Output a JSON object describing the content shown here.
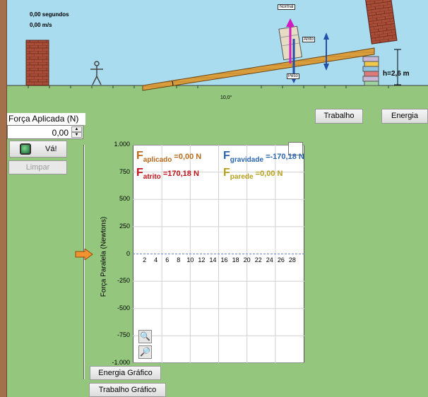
{
  "readouts": {
    "time": "0,00 segundos",
    "velocity": "0,00 m/s"
  },
  "scene": {
    "angle_label": "10,0°",
    "height_label": "h=2,6 m",
    "normal_label": "Normal",
    "friction_label": "Atrito",
    "weight_label": "Peso"
  },
  "controls": {
    "applied_force_title": "Força Aplicada (N)",
    "applied_force_value": "0,00",
    "go_label": "Vá!",
    "clear_label": "Limpar",
    "work_label": "Trabalho",
    "energy_label": "Energia",
    "energy_graph_label": "Energia Gráfico",
    "work_graph_label": "Trabalho Gráfico"
  },
  "forces": {
    "applied": {
      "sym": "F",
      "sub": "aplicado",
      "value": "=0,00 N",
      "color": "#b86a1b"
    },
    "friction": {
      "sym": "F",
      "sub": "atrito",
      "value": "=170,18 N",
      "color": "#c0141c"
    },
    "gravity": {
      "sym": "F",
      "sub": "gravidade",
      "value": "=-170,18 N",
      "color": "#2a66b0"
    },
    "wall": {
      "sym": "F",
      "sub": "parede",
      "value": "=0,00 N",
      "color": "#b5a01a"
    }
  },
  "chart_data": {
    "type": "line",
    "ylabel": "Força Paralela (Newtons)",
    "ylim": [
      -1000,
      1000
    ],
    "yticks": [
      "1.000",
      "750",
      "500",
      "250",
      "0",
      "-250",
      "-500",
      "-750",
      "-1.000"
    ],
    "ytick_values": [
      1000,
      750,
      500,
      250,
      0,
      -250,
      -500,
      -750,
      -1000
    ],
    "xlim": [
      0,
      30
    ],
    "xticks": [
      2,
      4,
      6,
      8,
      10,
      12,
      14,
      16,
      18,
      20,
      22,
      24,
      26,
      28
    ],
    "series": []
  },
  "colors": {
    "sky": "#a9dcef",
    "ground": "#94c67e",
    "brick": "#a84d38",
    "ramp": "#d99d3c",
    "arrow": "#f0922e"
  }
}
